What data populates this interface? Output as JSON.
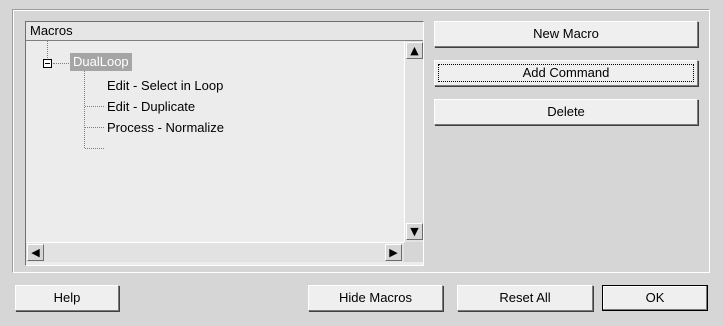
{
  "macros_panel": {
    "header": "Macros",
    "tree": {
      "root": {
        "label": "DualLoop",
        "expanded": true,
        "selected": true,
        "children": [
          {
            "label": "Edit - Select in Loop"
          },
          {
            "label": "Edit - Duplicate"
          },
          {
            "label": "Process - Normalize"
          }
        ]
      }
    },
    "scrollbars": {
      "up_arrow": "▲",
      "down_arrow": "▼",
      "left_arrow": "◀",
      "right_arrow": "▶"
    }
  },
  "side_buttons": {
    "new_macro": "New Macro",
    "add_command": "Add Command",
    "delete": "Delete"
  },
  "bottom_buttons": {
    "help": "Help",
    "hide_macros": "Hide Macros",
    "reset_all": "Reset All",
    "ok": "OK"
  },
  "colors": {
    "dialog_bg": "#d6d6d6",
    "list_bg": "#ececec",
    "selection_bg": "#a5a5a5",
    "selection_text": "#ffffff"
  }
}
